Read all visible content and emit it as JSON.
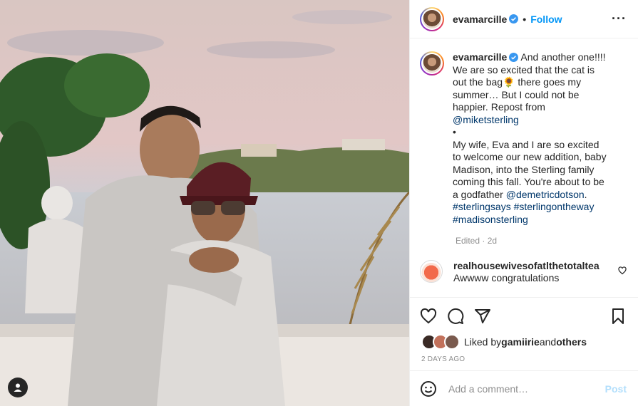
{
  "post": {
    "username": "evamarcille",
    "follow_label": "Follow",
    "more_label": "···"
  },
  "caption": {
    "username": "evamarcille",
    "text_1": " And another one!!!! We are so excited that the cat is out the bag🌻 there goes my summer… But I could not be happier. Repost from ",
    "mention_1": "@miketsterling",
    "bullet": "•",
    "text_2": "My wife, Eva and I are so excited to welcome our new addition, baby Madison, into the Sterling family coming this fall. You're about to be a godfather ",
    "mention_2": "@demetricdotson",
    "text_3": ".",
    "hashtags": "#sterlingsays #sterlingontheway #madisonsterling",
    "meta": "Edited · 2d"
  },
  "comments": [
    {
      "username": "realhousewivesofatlthetotaltea",
      "text": "Awwww congratulations"
    }
  ],
  "likes": {
    "prefix": "Liked by ",
    "user": "gamiirie",
    "middle": " and ",
    "others": "others"
  },
  "time_ago": "2 DAYS AGO",
  "add_comment": {
    "placeholder": "Add a comment…",
    "post_label": "Post"
  },
  "colors": {
    "accent": "#0095f6",
    "post_disabled": "#b2dffc",
    "link": "#00376b",
    "muted": "#8e8e8e"
  },
  "icons": [
    "verified-icon",
    "more-icon",
    "heart-icon",
    "comment-icon",
    "share-icon",
    "bookmark-icon",
    "emoji-icon",
    "user-tag-icon"
  ]
}
